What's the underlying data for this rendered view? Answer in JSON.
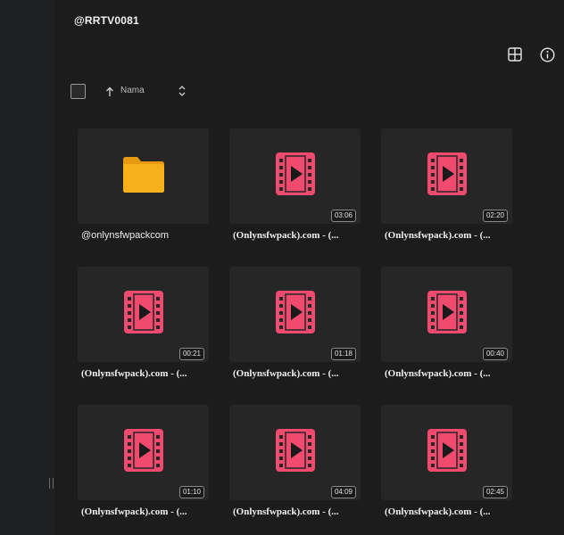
{
  "header": {
    "title": "@RRTV0081"
  },
  "toolbar": {
    "sort_label": "Nama"
  },
  "colors": {
    "folder": "#f6b01b",
    "video": "#f04a6e",
    "background": "#1c1c1d",
    "tile": "#262627"
  },
  "icons": {
    "view_toggle": "grid-view-icon",
    "info": "info-icon",
    "sort_direction": "arrow-up-icon",
    "sort_toggle": "sort-updown-icon",
    "folder": "folder-icon",
    "video": "video-file-icon"
  },
  "items": [
    {
      "type": "folder",
      "name": "@onlynsfwpackcom",
      "duration": ""
    },
    {
      "type": "video",
      "name": "(Onlynsfwpack).com - (...",
      "duration": "03:06"
    },
    {
      "type": "video",
      "name": "(Onlynsfwpack).com - (...",
      "duration": "02:20"
    },
    {
      "type": "video",
      "name": "(Onlynsfwpack).com - (...",
      "duration": "00:21"
    },
    {
      "type": "video",
      "name": "(Onlynsfwpack).com - (...",
      "duration": "01:18"
    },
    {
      "type": "video",
      "name": "(Onlynsfwpack).com - (...",
      "duration": "00:40"
    },
    {
      "type": "video",
      "name": "(Onlynsfwpack).com - (...",
      "duration": "01:10"
    },
    {
      "type": "video",
      "name": "(Onlynsfwpack).com - (...",
      "duration": "04:09"
    },
    {
      "type": "video",
      "name": "(Onlynsfwpack).com - (...",
      "duration": "02:45"
    }
  ]
}
